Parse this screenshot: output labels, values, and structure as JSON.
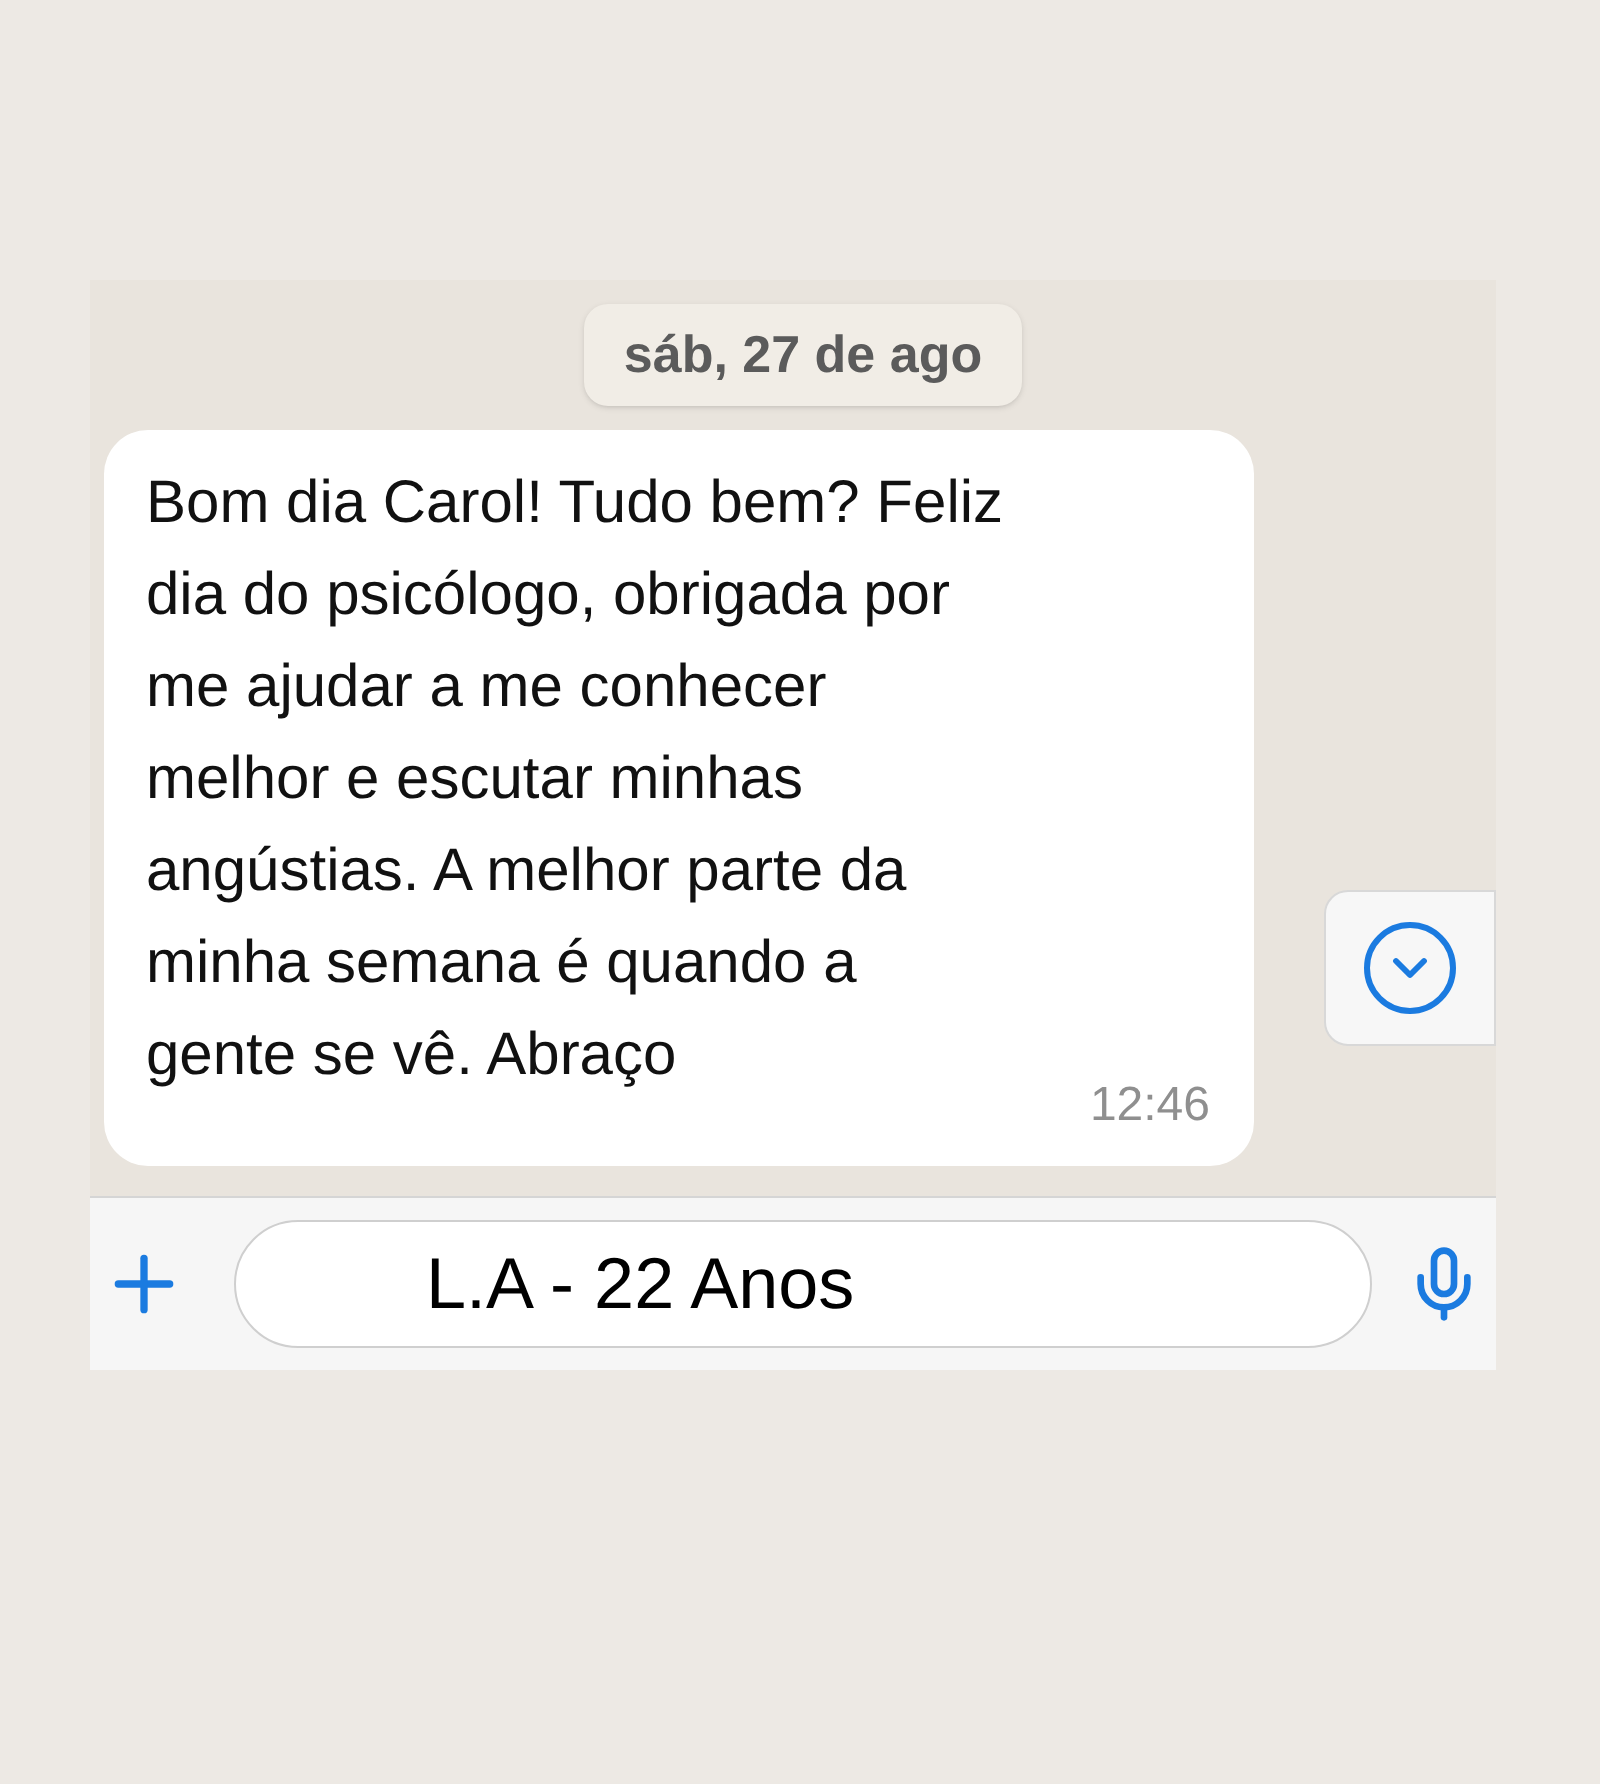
{
  "date_label": "sáb, 27 de ago",
  "message": {
    "lines": [
      "Bom dia Carol! Tudo bem? Feliz",
      "dia do psicólogo, obrigada por",
      "me ajudar a me conhecer",
      "melhor e escutar minhas",
      "angústias. A melhor parte da",
      "minha semana é quando a",
      "gente se vê. Abraço"
    ],
    "time": "12:46"
  },
  "input": {
    "value": "L.A - 22 Anos"
  }
}
